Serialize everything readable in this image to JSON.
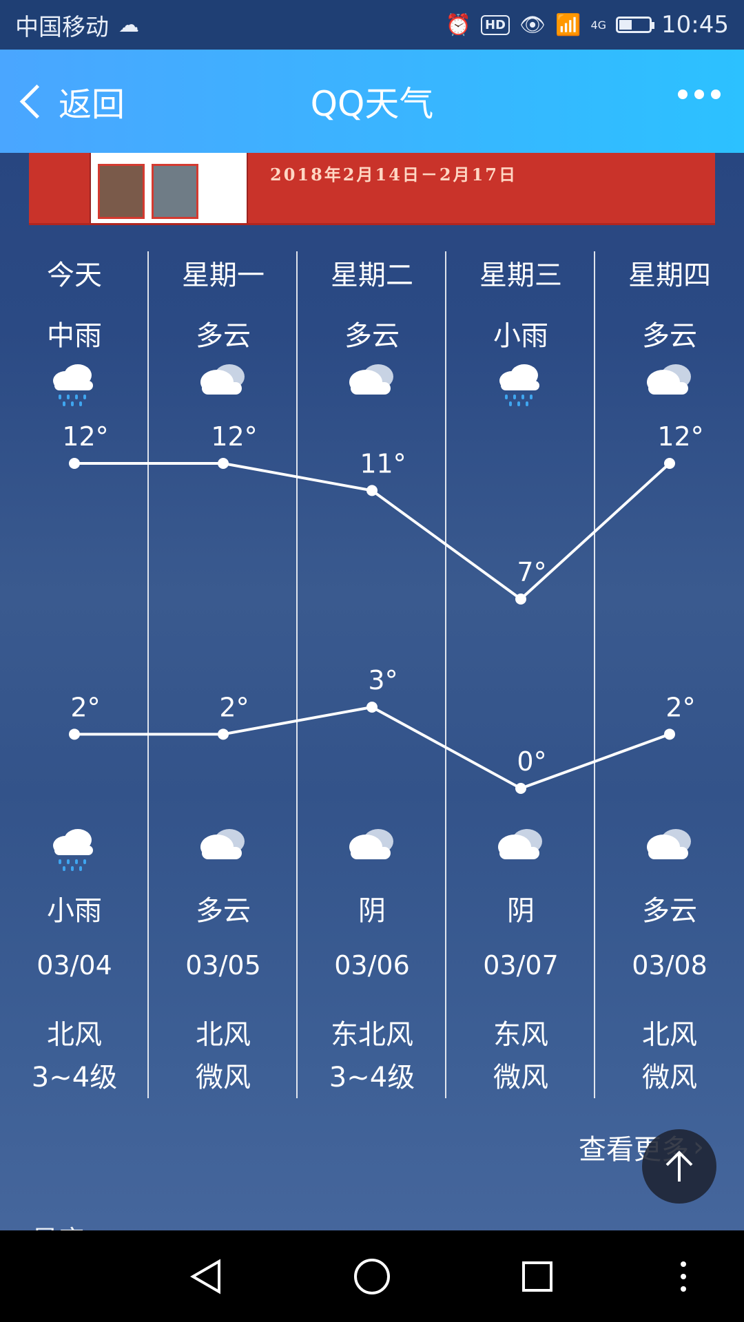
{
  "status_bar": {
    "carrier": "中国移动",
    "time": "10:45",
    "network": "4G",
    "hd": "HD"
  },
  "nav": {
    "back_label": "返回",
    "title": "QQ天气"
  },
  "banner": {
    "dates": "2018年2月14日－2月17日"
  },
  "forecast": [
    {
      "day": "今天",
      "day_weather": "中雨",
      "day_icon": "rain-cloud-icon",
      "high": "12°",
      "low": "2°",
      "night_icon": "rain-cloud-icon",
      "night_weather": "小雨",
      "date": "03/04",
      "wind_dir": "北风",
      "wind_level": "3~4级"
    },
    {
      "day": "星期一",
      "day_weather": "多云",
      "day_icon": "cloud-icon",
      "high": "12°",
      "low": "2°",
      "night_icon": "cloud-icon",
      "night_weather": "多云",
      "date": "03/05",
      "wind_dir": "北风",
      "wind_level": "微风"
    },
    {
      "day": "星期二",
      "day_weather": "多云",
      "day_icon": "cloud-icon",
      "high": "11°",
      "low": "3°",
      "night_icon": "cloud-icon",
      "night_weather": "阴",
      "date": "03/06",
      "wind_dir": "东北风",
      "wind_level": "3~4级"
    },
    {
      "day": "星期三",
      "day_weather": "小雨",
      "day_icon": "rain-cloud-icon",
      "high": "7°",
      "low": "0°",
      "night_icon": "cloud-icon",
      "night_weather": "阴",
      "date": "03/07",
      "wind_dir": "东风",
      "wind_level": "微风"
    },
    {
      "day": "星期四",
      "day_weather": "多云",
      "day_icon": "cloud-icon",
      "high": "12°",
      "low": "2°",
      "night_icon": "cloud-icon",
      "night_weather": "多云",
      "date": "03/08",
      "wind_dir": "北风",
      "wind_level": "微风"
    }
  ],
  "chart_data": {
    "type": "line",
    "categories": [
      "03/04",
      "03/05",
      "03/06",
      "03/07",
      "03/08"
    ],
    "series": [
      {
        "values": [
          12,
          12,
          11,
          7,
          12
        ]
      },
      {
        "values": [
          2,
          2,
          3,
          0,
          2
        ]
      }
    ],
    "unit": "°"
  },
  "footer": {
    "more_label": "查看更多",
    "next_section_title": "星座"
  }
}
